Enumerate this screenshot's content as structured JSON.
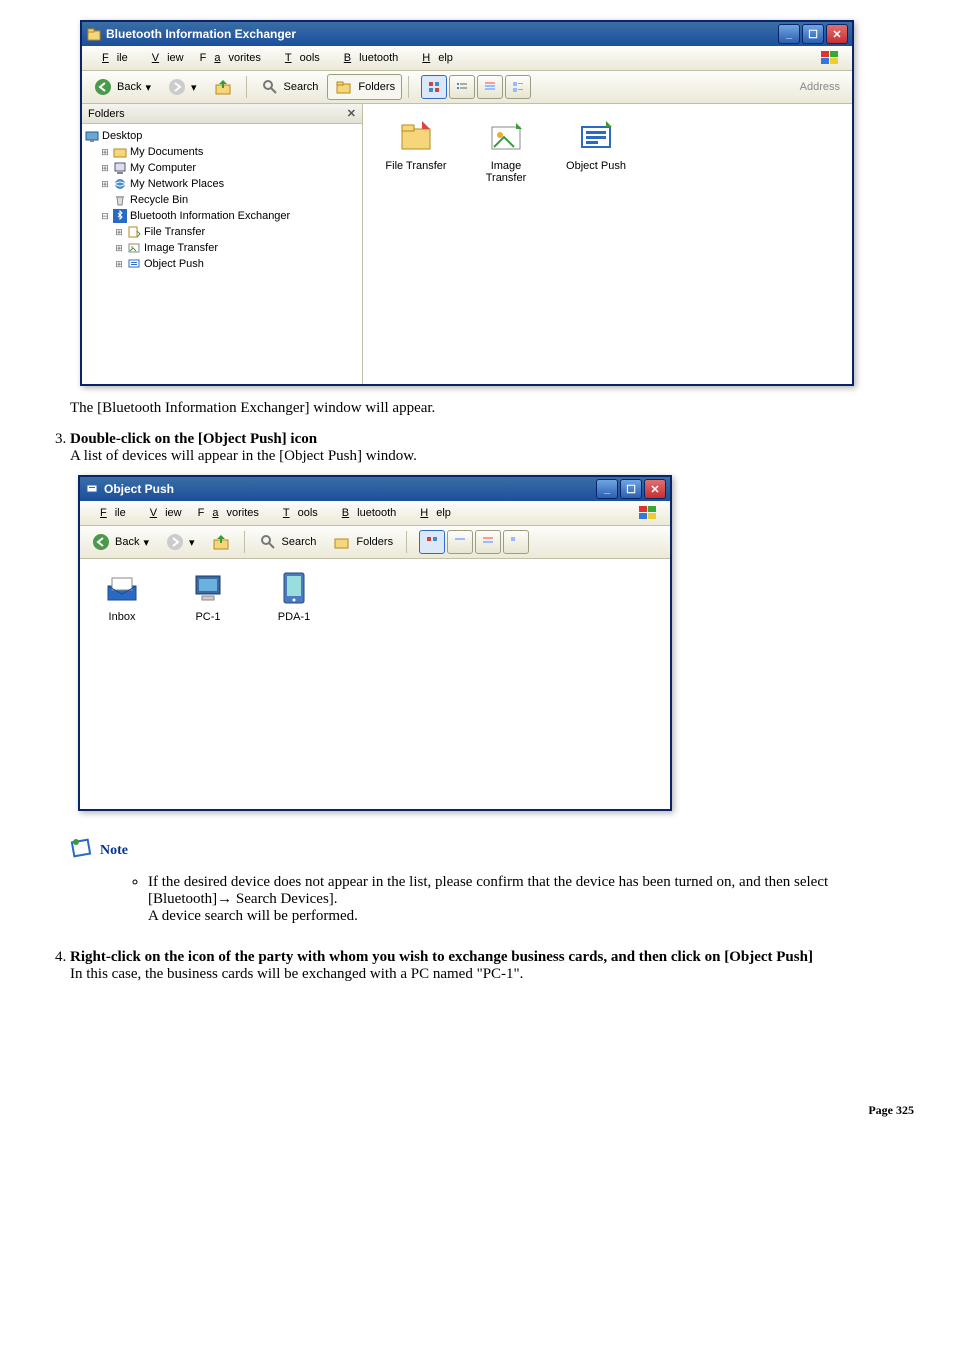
{
  "win1": {
    "title": "Bluetooth Information Exchanger",
    "menu": [
      "File",
      "View",
      "Favorites",
      "Tools",
      "Bluetooth",
      "Help"
    ],
    "toolbar": {
      "back": "Back",
      "search": "Search",
      "folders": "Folders",
      "address": "Address"
    },
    "folders_header": "Folders",
    "tree": {
      "desktop": "Desktop",
      "mydocs": "My Documents",
      "mycomp": "My Computer",
      "mynet": "My Network Places",
      "recycle": "Recycle Bin",
      "bix": "Bluetooth Information Exchanger",
      "ft": "File Transfer",
      "it": "Image Transfer",
      "op": "Object Push"
    },
    "icons": {
      "ft": "File Transfer",
      "it": "Image\nTransfer",
      "op": "Object Push"
    }
  },
  "caption1": "The [Bluetooth Information Exchanger] window will appear.",
  "step3": {
    "title": "Double-click on the [Object Push] icon",
    "sub": "A list of devices will appear in the [Object Push] window."
  },
  "win2": {
    "title": "Object Push",
    "menu": [
      "File",
      "View",
      "Favorites",
      "Tools",
      "Bluetooth",
      "Help"
    ],
    "toolbar": {
      "back": "Back",
      "search": "Search",
      "folders": "Folders"
    },
    "items": {
      "inbox": "Inbox",
      "pc1": "PC-1",
      "pda1": "PDA-1"
    }
  },
  "note": {
    "label": "Note",
    "bullet1a": "If the desired device does not appear in the list, please confirm that the device has been turned on, and then select [Bluetooth]→ Search Devices].",
    "bullet1b": "A device search will be performed."
  },
  "step4": {
    "title": "Right-click on the icon of the party with whom you wish to exchange business cards, and then click on [Object Push]",
    "sub": "In this case, the business cards will be exchanged with a PC named \"PC-1\"."
  },
  "footer": {
    "label": "Page",
    "num": "325"
  }
}
